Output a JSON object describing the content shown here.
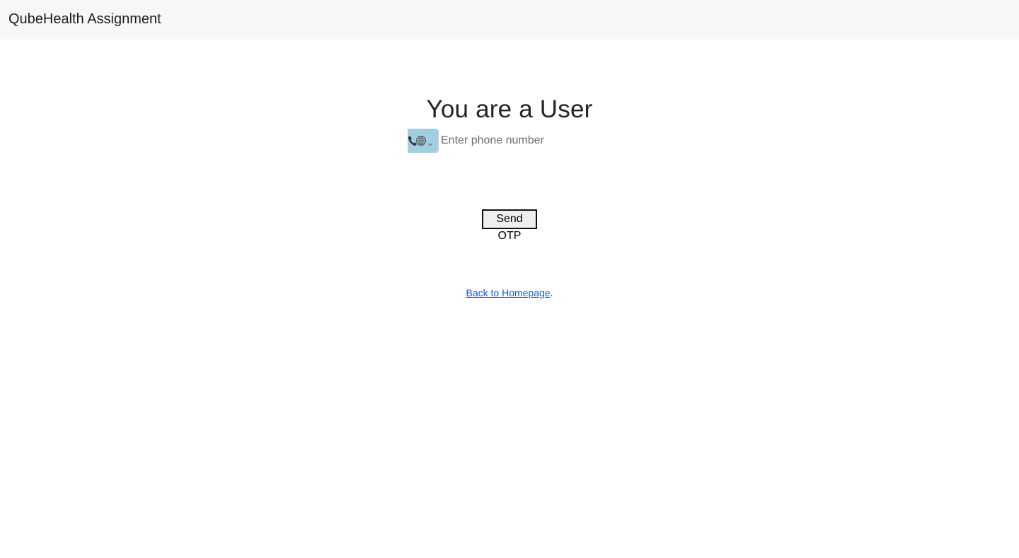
{
  "navbar": {
    "brand": "QubeHealth Assignment"
  },
  "main": {
    "title": "You are a User",
    "phone": {
      "country_icons": [
        "phone-icon",
        "globe-icon",
        "chevron-down-icon"
      ],
      "placeholder": "Enter phone number",
      "value": ""
    },
    "send_otp_label": "Send OTP",
    "back_link_text": "Back to Homepage",
    "back_link_suffix": "."
  },
  "colors": {
    "navbar_bg": "#f7f7f8",
    "country_select_bg": "#9fcfe0",
    "link": "#1a56db",
    "button_bg": "#efefef",
    "button_border": "#111111"
  }
}
